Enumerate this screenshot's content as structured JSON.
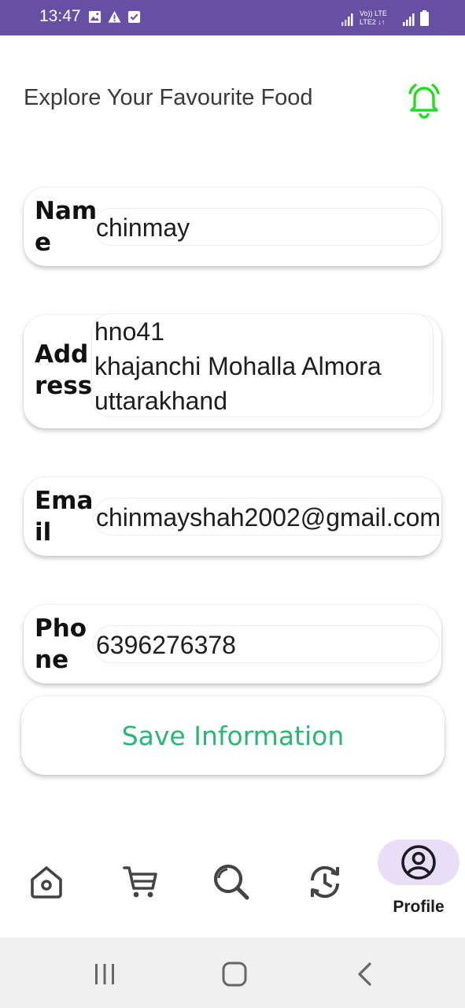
{
  "status_bar": {
    "time": "13:47",
    "left_icons": [
      "image-icon",
      "warning-icon",
      "check-box-icon"
    ],
    "right_icons": [
      "signal-icon",
      "volte-lte2-icon",
      "signal-icon",
      "battery-icon"
    ],
    "network_label_1": "Vo)) LTE",
    "network_label_2": "LTE2"
  },
  "header": {
    "title": "Explore Your Favourite Food",
    "notification_icon": "bell-icon",
    "accent": "#22dd22"
  },
  "form": {
    "name": {
      "label": "Name",
      "value": "chinmay"
    },
    "address": {
      "label": "Address",
      "value": "hno41\nkhajanchi Mohalla Almora\nuttarakhand"
    },
    "email": {
      "label": "Email",
      "value": "chinmayshah2002@gmail.com"
    },
    "phone": {
      "label": "Phone",
      "value": "6396276378"
    },
    "save_label": "Save Information",
    "save_color": "#2bb673"
  },
  "bottom_nav": {
    "items": [
      {
        "icon": "home-icon"
      },
      {
        "icon": "cart-icon"
      },
      {
        "icon": "search-icon"
      },
      {
        "icon": "history-icon"
      },
      {
        "icon": "profile-icon",
        "label": "Profile",
        "selected": true
      }
    ],
    "selected_pill_color": "#e8def8"
  },
  "system_nav": {
    "icons": [
      "recent-apps-icon",
      "home-button-icon",
      "back-icon"
    ]
  },
  "colors": {
    "status_bar": "#6750a4",
    "system_nav": "#f0f0f0"
  }
}
